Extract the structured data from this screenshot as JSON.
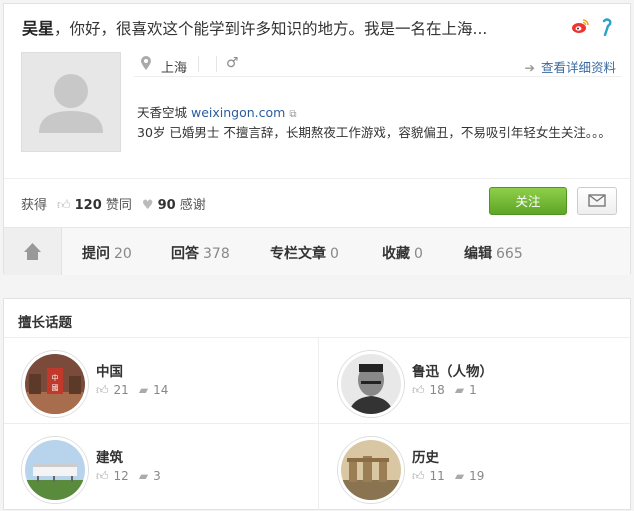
{
  "profile": {
    "name": "吴星",
    "headline": "，你好，很喜欢这个能学到许多知识的地方。我是一名在上海...",
    "location": "上海",
    "gender_symbol": "♂",
    "detail_link": "查看详细资料",
    "company": "天香空城",
    "website": "weixingon.com",
    "bio": "30岁 已婚男士 不擅言辞，长期熬夜工作游戏，容貌偏丑，不易吸引年轻女生关注。。。",
    "stats": {
      "label": "获得",
      "likes": "120",
      "likes_label": "赞同",
      "thanks": "90",
      "thanks_label": "感谢"
    },
    "follow_label": "关注"
  },
  "nav": {
    "tabs": [
      {
        "label": "提问",
        "count": "20"
      },
      {
        "label": "回答",
        "count": "378"
      },
      {
        "label": "专栏文章",
        "count": "0"
      },
      {
        "label": "收藏",
        "count": "0"
      },
      {
        "label": "编辑",
        "count": "665"
      }
    ]
  },
  "topics": {
    "title": "擅长话题",
    "items": [
      {
        "name": "中国",
        "likes": "21",
        "answers": "14",
        "image": "china-photo"
      },
      {
        "name": "鲁迅（人物）",
        "likes": "18",
        "answers": "1",
        "image": "luxun-portrait"
      },
      {
        "name": "建筑",
        "likes": "12",
        "answers": "3",
        "image": "building-photo"
      },
      {
        "name": "历史",
        "likes": "11",
        "answers": "19",
        "image": "ruins-photo"
      }
    ]
  },
  "colors": {
    "link": "#2a5d9e",
    "follow": "#6db33f"
  },
  "icons": [
    "weibo-icon",
    "qq-icon",
    "location-icon",
    "male-icon",
    "arrow-right-icon",
    "external-link-icon",
    "thumb-up-icon",
    "heart-icon",
    "mail-icon",
    "home-icon",
    "comment-icon"
  ]
}
